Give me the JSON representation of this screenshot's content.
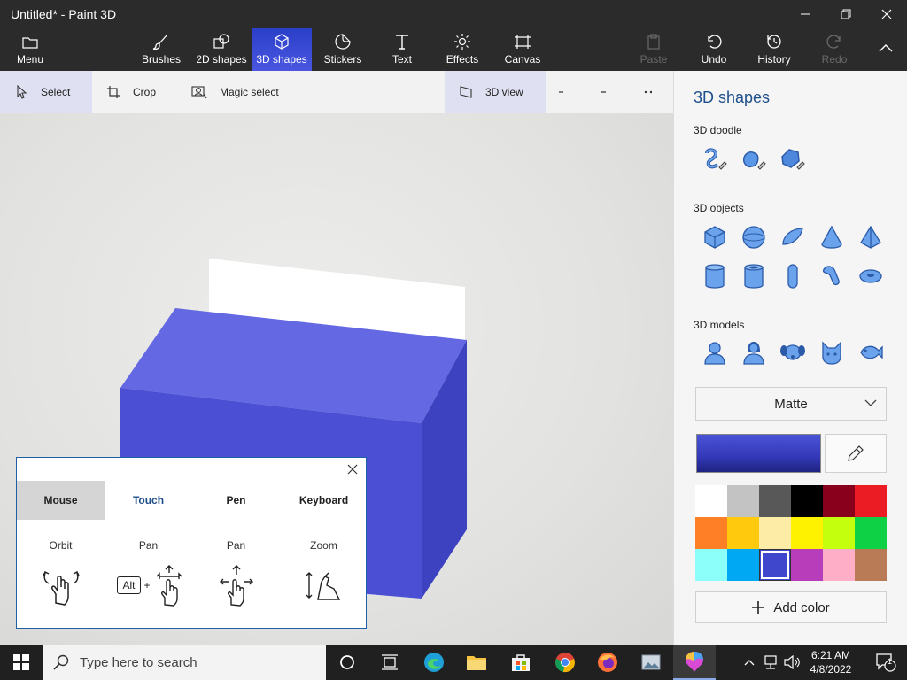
{
  "window": {
    "title": "Untitled* - Paint 3D"
  },
  "ribbon": {
    "menu": "Menu",
    "brushes": "Brushes",
    "shapes2d": "2D shapes",
    "shapes3d": "3D shapes",
    "stickers": "Stickers",
    "text": "Text",
    "effects": "Effects",
    "canvas": "Canvas",
    "paste": "Paste",
    "undo": "Undo",
    "history": "History",
    "redo": "Redo"
  },
  "toolbar": {
    "select": "Select",
    "crop": "Crop",
    "magic_select": "Magic select",
    "view3d": "3D view"
  },
  "panel": {
    "title": "3D shapes",
    "doodle_label": "3D doodle",
    "objects_label": "3D objects",
    "models_label": "3D models",
    "finish": "Matte",
    "add_color": "Add color",
    "current_color": "#3b42c4",
    "palette": [
      "#ffffff",
      "#c3c3c3",
      "#585858",
      "#000000",
      "#88001b",
      "#ec1c24",
      "#ff7f27",
      "#ffc90e",
      "#fdeca6",
      "#fff200",
      "#c4ff0e",
      "#0ed145",
      "#8cfffb",
      "#00a8f3",
      "#3f48cc",
      "#b83dba",
      "#ffaec8",
      "#b97a56"
    ],
    "selected_swatch": 14
  },
  "help_popup": {
    "tabs": [
      "Mouse",
      "Touch",
      "Pen",
      "Keyboard"
    ],
    "active_tab": "Touch",
    "gestures": [
      "Orbit",
      "Pan",
      "Pan",
      "Zoom"
    ],
    "alt_key": "Alt"
  },
  "taskbar": {
    "search_placeholder": "Type here to search",
    "time": "6:21 AM",
    "date": "4/8/2022",
    "notification_count": "1"
  }
}
